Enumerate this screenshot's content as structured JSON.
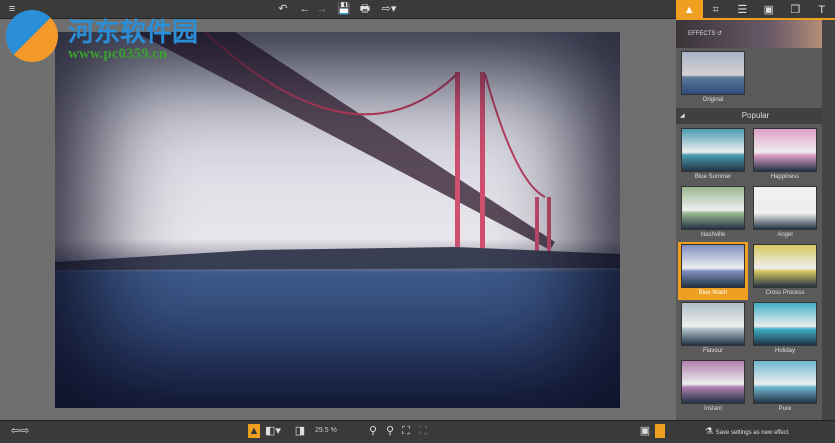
{
  "toolbar": {
    "menu": "≡",
    "undo_all": "↶",
    "undo": "←",
    "redo": "→",
    "save": "💾",
    "print": "🖶",
    "export": "⇨▾"
  },
  "watermark": {
    "title": "河东软件园",
    "url": "www.pc0359.cn"
  },
  "panel": {
    "tabs": [
      {
        "name": "effects",
        "glyph": "▲"
      },
      {
        "name": "crop",
        "glyph": "⌗"
      },
      {
        "name": "adjust",
        "glyph": "☰"
      },
      {
        "name": "frame",
        "glyph": "▣"
      },
      {
        "name": "layers",
        "glyph": "❐"
      },
      {
        "name": "text",
        "glyph": "T"
      }
    ],
    "banner_label": "EFFECTS ↺",
    "original_label": "Original",
    "section": "Popular",
    "effects": [
      {
        "label": "Blue Summer",
        "tint": "#4a9cb0"
      },
      {
        "label": "Happiness",
        "tint": "#e0a0c8"
      },
      {
        "label": "Nashville",
        "tint": "#9ab890"
      },
      {
        "label": "Angel",
        "tint": "#f0f0f0"
      },
      {
        "label": "Blue Wash",
        "tint": "#8090c0"
      },
      {
        "label": "Cross Process",
        "tint": "#d8c860"
      },
      {
        "label": "Flavour",
        "tint": "#b0c0c8"
      },
      {
        "label": "Holiday",
        "tint": "#40b0c8"
      },
      {
        "label": "Instant",
        "tint": "#b080b0"
      },
      {
        "label": "Pure",
        "tint": "#70b8d0"
      }
    ],
    "selected": "Blue Wash"
  },
  "bottom": {
    "zoom": "29.5 %",
    "save_effect": "Save settings as new effect"
  }
}
